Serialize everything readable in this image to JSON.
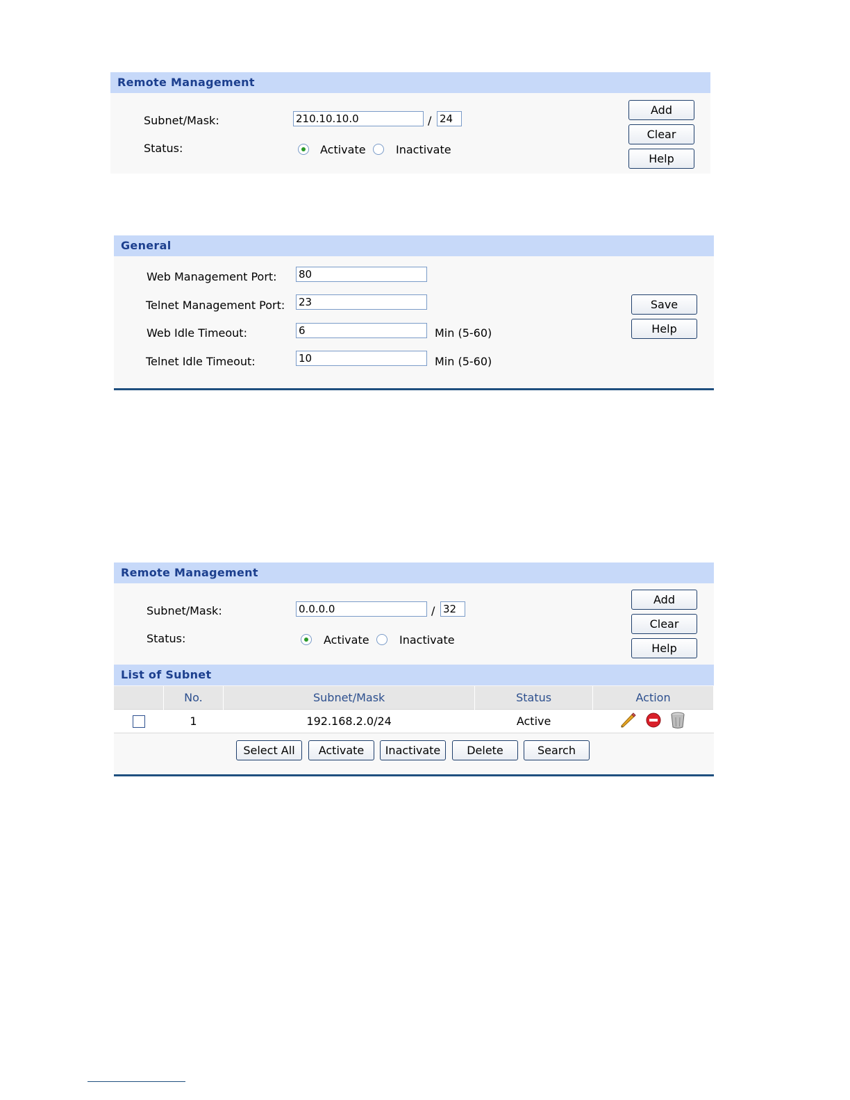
{
  "panel1": {
    "title": "Remote Management",
    "subnet_label": "Subnet/Mask:",
    "subnet_value": "210.10.10.0",
    "separator": "/",
    "mask_value": "24",
    "status_label": "Status:",
    "activate_label": "Activate",
    "inactivate_label": "Inactivate",
    "status_selected": "Activate",
    "add_label": "Add",
    "clear_label": "Clear",
    "help_label": "Help"
  },
  "panel2": {
    "title": "General",
    "web_port_label": "Web Management Port:",
    "web_port_value": "80",
    "telnet_port_label": "Telnet Management Port:",
    "telnet_port_value": "23",
    "web_timeout_label": "Web Idle Timeout:",
    "web_timeout_value": "6",
    "web_timeout_unit": "Min (5-60)",
    "telnet_timeout_label": "Telnet Idle Timeout:",
    "telnet_timeout_value": "10",
    "telnet_timeout_unit": "Min (5-60)",
    "save_label": "Save",
    "help_label": "Help"
  },
  "panel3": {
    "title": "Remote Management",
    "subnet_label": "Subnet/Mask:",
    "subnet_value": "0.0.0.0",
    "separator": "/",
    "mask_value": "32",
    "status_label": "Status:",
    "activate_label": "Activate",
    "inactivate_label": "Inactivate",
    "status_selected": "Activate",
    "add_label": "Add",
    "clear_label": "Clear",
    "help_label": "Help",
    "list_title": "List of Subnet",
    "columns": [
      "",
      "No.",
      "Subnet/Mask",
      "Status",
      "Action"
    ],
    "rows": [
      {
        "checked": false,
        "no": "1",
        "subnet": "192.168.2.0/24",
        "status": "Active",
        "actions": [
          "edit-icon",
          "disable-icon",
          "trash-icon"
        ]
      }
    ],
    "select_all_label": "Select All",
    "activate_btn_label": "Activate",
    "inactivate_btn_label": "Inactivate",
    "delete_label": "Delete",
    "search_label": "Search"
  },
  "colors": {
    "header_bg": "#c7d9f9",
    "header_text": "#1c3f8e",
    "rule": "#1f4f7f",
    "radio_on": "#2b9a2b"
  }
}
